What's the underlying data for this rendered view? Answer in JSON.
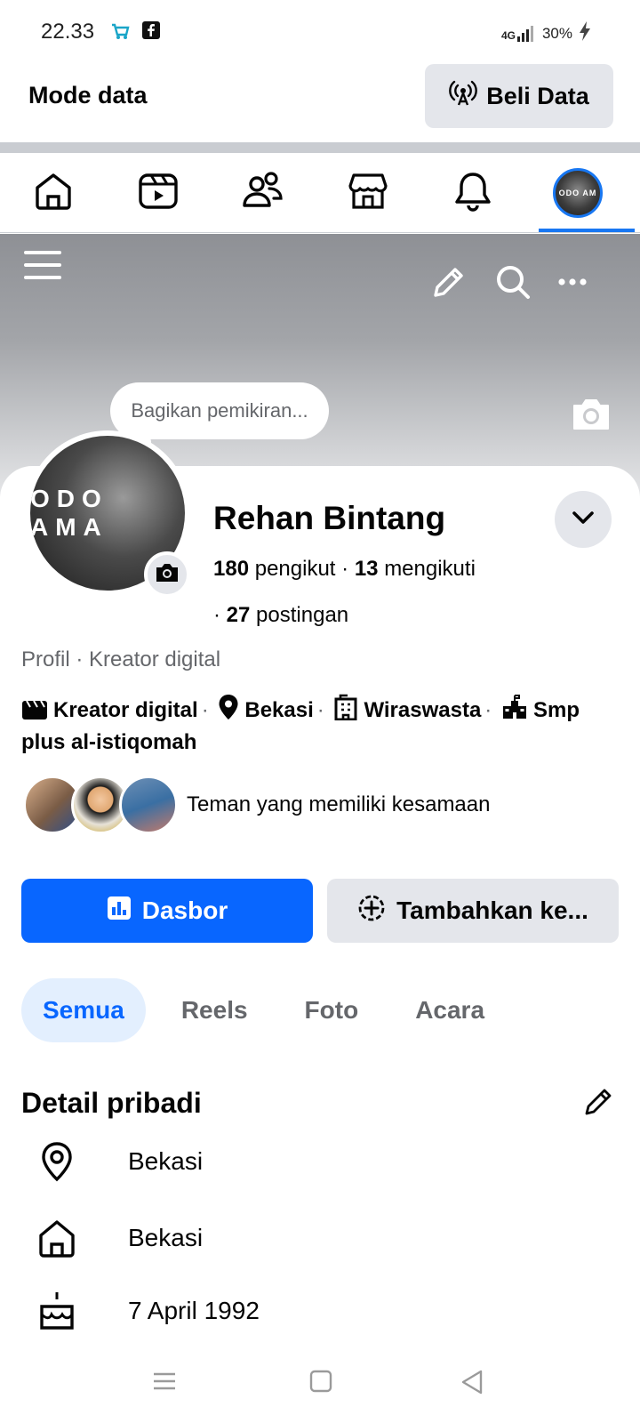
{
  "status_bar": {
    "time": "22.33",
    "network": "4G",
    "battery": "30%"
  },
  "data_bar": {
    "title": "Mode data",
    "buy_label": "Beli Data"
  },
  "nav": {
    "items": [
      "home-icon",
      "video-icon",
      "friends-icon",
      "marketplace-icon",
      "bell-icon",
      "profile-avatar"
    ],
    "avatar_text": "ODO AM"
  },
  "cover": {
    "thought_placeholder": "Bagikan pemikiran..."
  },
  "profile": {
    "avatar_text": "ODO AMA",
    "name": "Rehan Bintang",
    "followers_count": "180",
    "followers_label": "pengikut",
    "following_count": "13",
    "following_label": "mengikuti",
    "posts_count": "27",
    "posts_label": "postingan",
    "type": "Profil · Kreator digital"
  },
  "info": {
    "category": "Kreator digital",
    "location": "Bekasi",
    "work": "Wiraswasta",
    "school": "Smp plus al-istiqomah"
  },
  "mutual": {
    "text": "Teman yang memiliki kesamaan"
  },
  "actions": {
    "dashboard_label": "Dasbor",
    "add_label": "Tambahkan ke..."
  },
  "tabs": [
    "Semua",
    "Reels",
    "Foto",
    "Acara"
  ],
  "details": {
    "title": "Detail pribadi",
    "rows": [
      {
        "icon": "pin-icon",
        "text": "Bekasi"
      },
      {
        "icon": "home-icon",
        "text": "Bekasi"
      },
      {
        "icon": "cake-icon",
        "text": "7 April 1992"
      }
    ]
  },
  "colors": {
    "primary": "#0866ff",
    "light_gray": "#e4e6eb",
    "secondary_text": "#65676b"
  }
}
